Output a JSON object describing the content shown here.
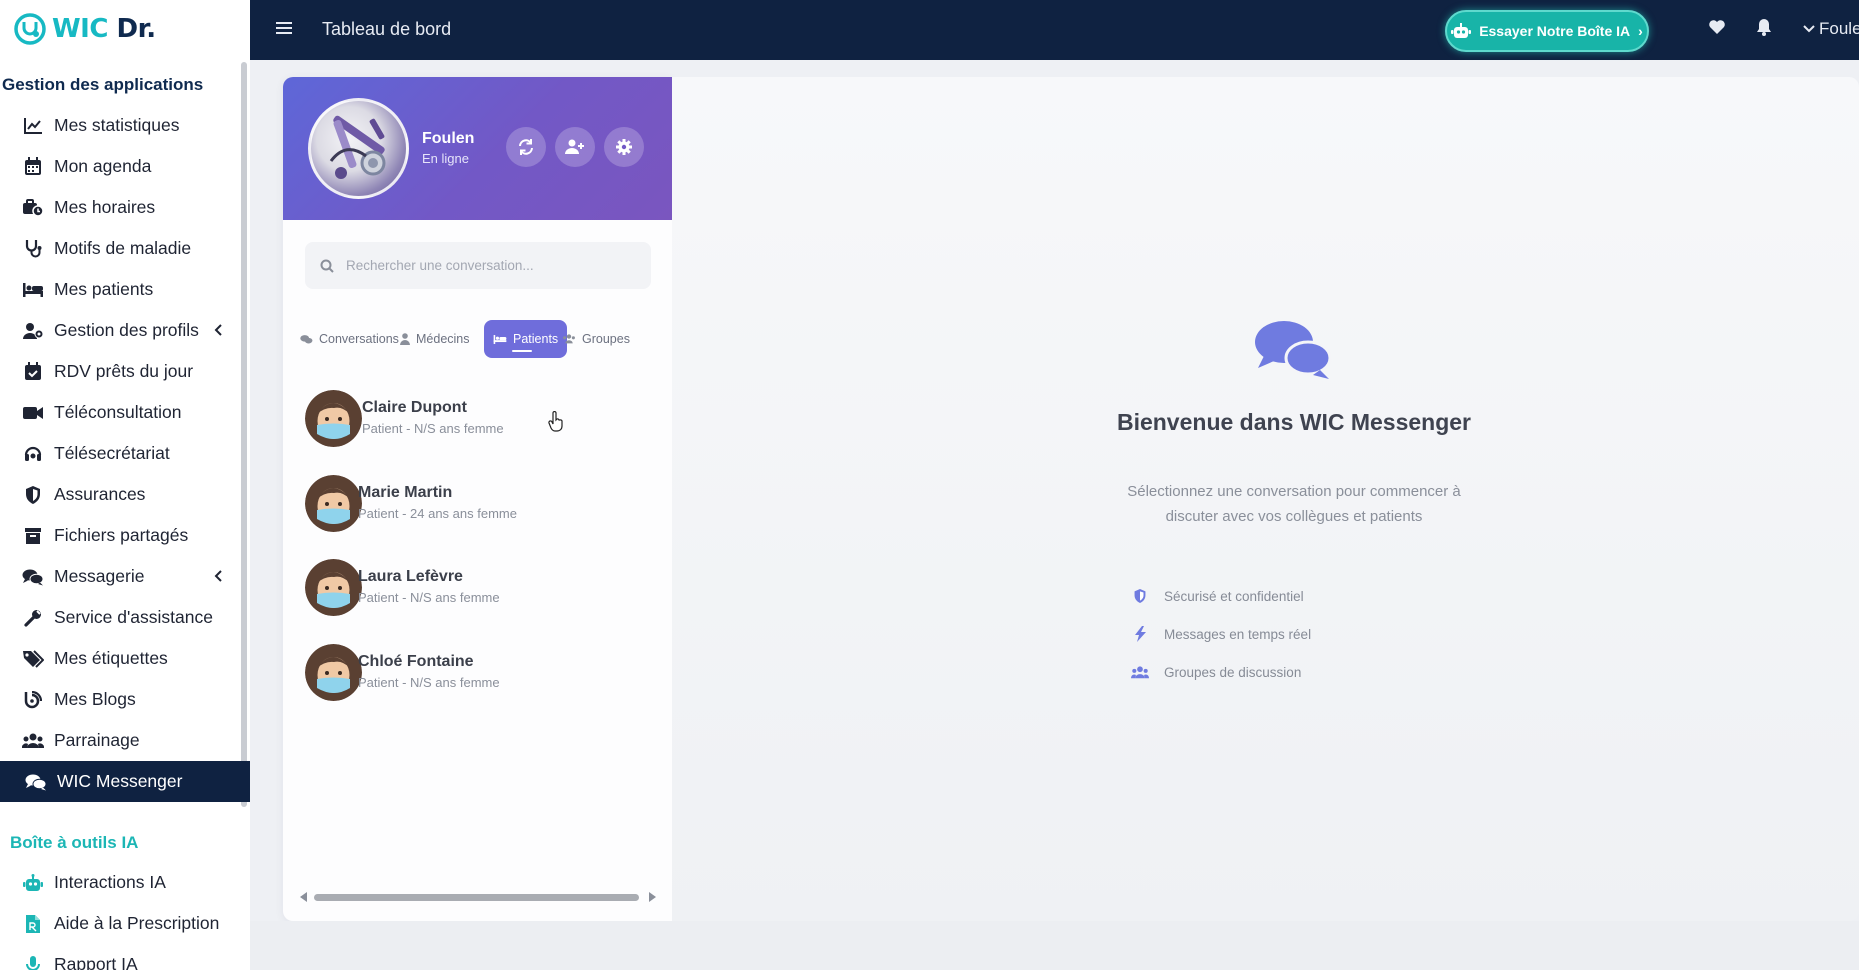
{
  "app": {
    "logo_wic": "WIC",
    "logo_dr": "Dr.",
    "page_title": "Tableau de bord"
  },
  "topbar": {
    "ai_button_label": "Essayer Notre Boîte IA",
    "ai_button_chevron": "›",
    "user_label": "Foule"
  },
  "sidebar": {
    "section_apps": "Gestion des applications",
    "items": [
      {
        "label": "Mes statistiques",
        "icon": "chart-line-icon"
      },
      {
        "label": "Mon agenda",
        "icon": "calendar-icon"
      },
      {
        "label": "Mes horaires",
        "icon": "schedule-icon"
      },
      {
        "label": "Motifs de maladie",
        "icon": "stethoscope-icon"
      },
      {
        "label": "Mes patients",
        "icon": "bed-icon"
      },
      {
        "label": "Gestion des profils",
        "icon": "user-gear-icon",
        "expandable": true
      },
      {
        "label": "RDV prêts du jour",
        "icon": "calendar-check-icon"
      },
      {
        "label": "Téléconsultation",
        "icon": "video-icon"
      },
      {
        "label": "Télésecrétariat",
        "icon": "headset-icon"
      },
      {
        "label": "Assurances",
        "icon": "shield-icon"
      },
      {
        "label": "Fichiers partagés",
        "icon": "archive-icon"
      },
      {
        "label": "Messagerie",
        "icon": "comments-icon",
        "expandable": true
      },
      {
        "label": "Service d'assistance",
        "icon": "wrench-icon"
      },
      {
        "label": "Mes étiquettes",
        "icon": "tags-icon"
      },
      {
        "label": "Mes Blogs",
        "icon": "blog-icon"
      },
      {
        "label": "Parrainage",
        "icon": "users-icon"
      },
      {
        "label": "WIC Messenger",
        "icon": "comments-icon",
        "active": true
      }
    ],
    "section_ai": "Boîte à outils IA",
    "ai_items": [
      {
        "label": "Interactions IA",
        "icon": "robot-icon"
      },
      {
        "label": "Aide à la Prescription",
        "icon": "file-prescription-icon"
      },
      {
        "label": "Rapport IA",
        "icon": "microphone-icon"
      }
    ]
  },
  "profile": {
    "name": "Foulen",
    "status": "En ligne"
  },
  "search": {
    "placeholder": "Rechercher une conversation..."
  },
  "tabs": [
    {
      "label": "Conversations",
      "icon": "comments-icon"
    },
    {
      "label": "Médecins",
      "icon": "user-md-icon"
    },
    {
      "label": "Patients",
      "icon": "bed-icon",
      "active": true
    },
    {
      "label": "Groupes",
      "icon": "users-icon"
    }
  ],
  "contacts": [
    {
      "name": "Claire Dupont",
      "subtitle": "Patient - N/S ans femme"
    },
    {
      "name": "Marie Martin",
      "subtitle": "Patient - 24 ans ans femme"
    },
    {
      "name": "Laura Lefèvre",
      "subtitle": "Patient - N/S ans femme"
    },
    {
      "name": "Chloé Fontaine",
      "subtitle": "Patient - N/S ans femme"
    }
  ],
  "welcome": {
    "title": "Bienvenue dans WIC Messenger",
    "subtitle": "Sélectionnez une conversation pour commencer à discuter avec vos collègues et patients",
    "features": [
      {
        "label": "Sécurisé et confidentiel",
        "icon": "shield-icon"
      },
      {
        "label": "Messages en temps réel",
        "icon": "bolt-icon"
      },
      {
        "label": "Groupes de discussion",
        "icon": "users-icon"
      }
    ]
  },
  "colors": {
    "navy": "#0f2241",
    "teal": "#18b4a8",
    "purple": "#6f6ddb",
    "icon_blue": "#6f7be0"
  }
}
